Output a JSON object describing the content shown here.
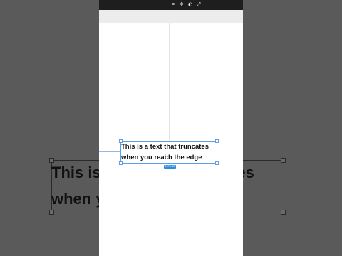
{
  "text_layer": {
    "content": "This is a text that truncates\nwhen you reach the edge",
    "dimension_badge": "137×32"
  },
  "background_zoom": {
    "content": "This is a text that truncates\nwhen you reach the edge"
  },
  "toolbar": {
    "icons": [
      "frame-icon",
      "move-icon",
      "contrast-icon",
      "resize-icon"
    ],
    "glyphs": [
      "⌗",
      "✥",
      "◐",
      "⤢"
    ]
  }
}
